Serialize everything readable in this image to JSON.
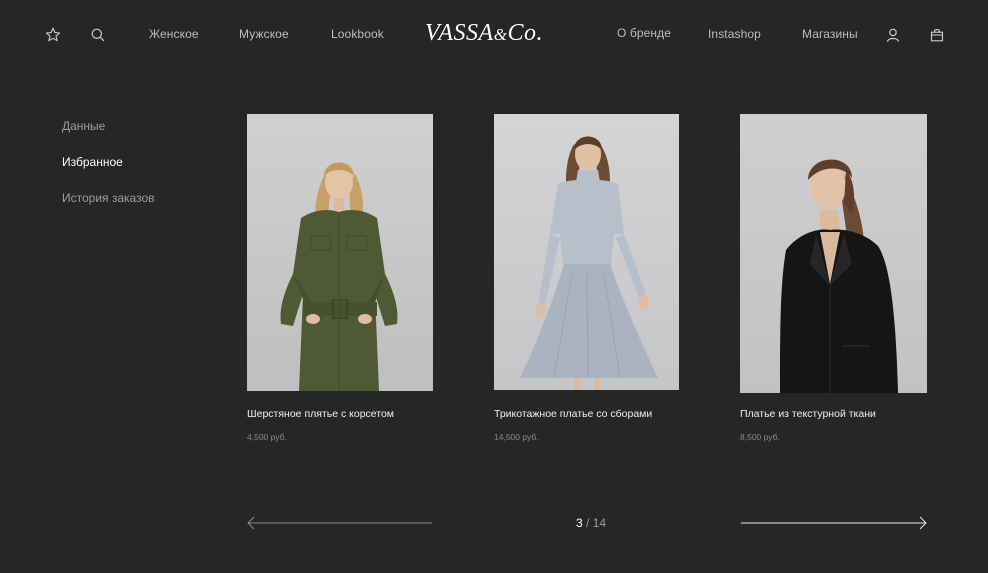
{
  "header": {
    "brand": "VASSA",
    "brand_amp": "&",
    "brand_suffix": "Co.",
    "nav_left": [
      "Женское",
      "Мужское",
      "Lookbook"
    ],
    "nav_right": [
      "О бренде",
      "Instashop",
      "Магазины"
    ],
    "icons": [
      "star-icon",
      "search-icon",
      "user-icon",
      "shopping-bag-icon"
    ]
  },
  "sidebar": {
    "items": [
      {
        "label": "Данные",
        "active": false
      },
      {
        "label": "Избранное",
        "active": true
      },
      {
        "label": "История заказов",
        "active": false
      }
    ]
  },
  "products": [
    {
      "name": "Шерстяное плятье с корсетом",
      "price": "4,500 руб.",
      "garment": "olive utility dress with belt",
      "garment_color": "#4f5a35"
    },
    {
      "name": "Трикотажное платье со сборами",
      "price": "14,500 руб.",
      "garment": "light blue-grey flared dress",
      "garment_color": "#b6bfca"
    },
    {
      "name": "Платье из текстурной ткани",
      "price": "8,500 руб.",
      "garment": "black blazer dress",
      "garment_color": "#151515"
    }
  ],
  "pager": {
    "current": "3",
    "separator": "/",
    "total": "14"
  },
  "colors": {
    "background": "#262626",
    "text_primary": "#ffffff",
    "text_muted": "#9c9c9c",
    "photo_backdrop": "#c9c9cb"
  }
}
